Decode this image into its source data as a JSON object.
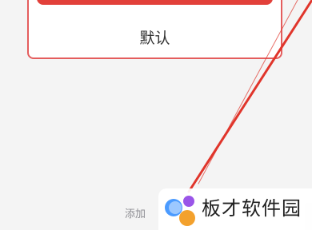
{
  "card": {
    "default_label": "默认"
  },
  "footer": {
    "add_label": "添加"
  },
  "watermark": {
    "text": "板才软件园",
    "logo_icon": "colorful-dots-logo-icon"
  },
  "colors": {
    "accent_red": "#e2403a",
    "card_border": "#e45d5d",
    "arrow": "#e0352b"
  }
}
